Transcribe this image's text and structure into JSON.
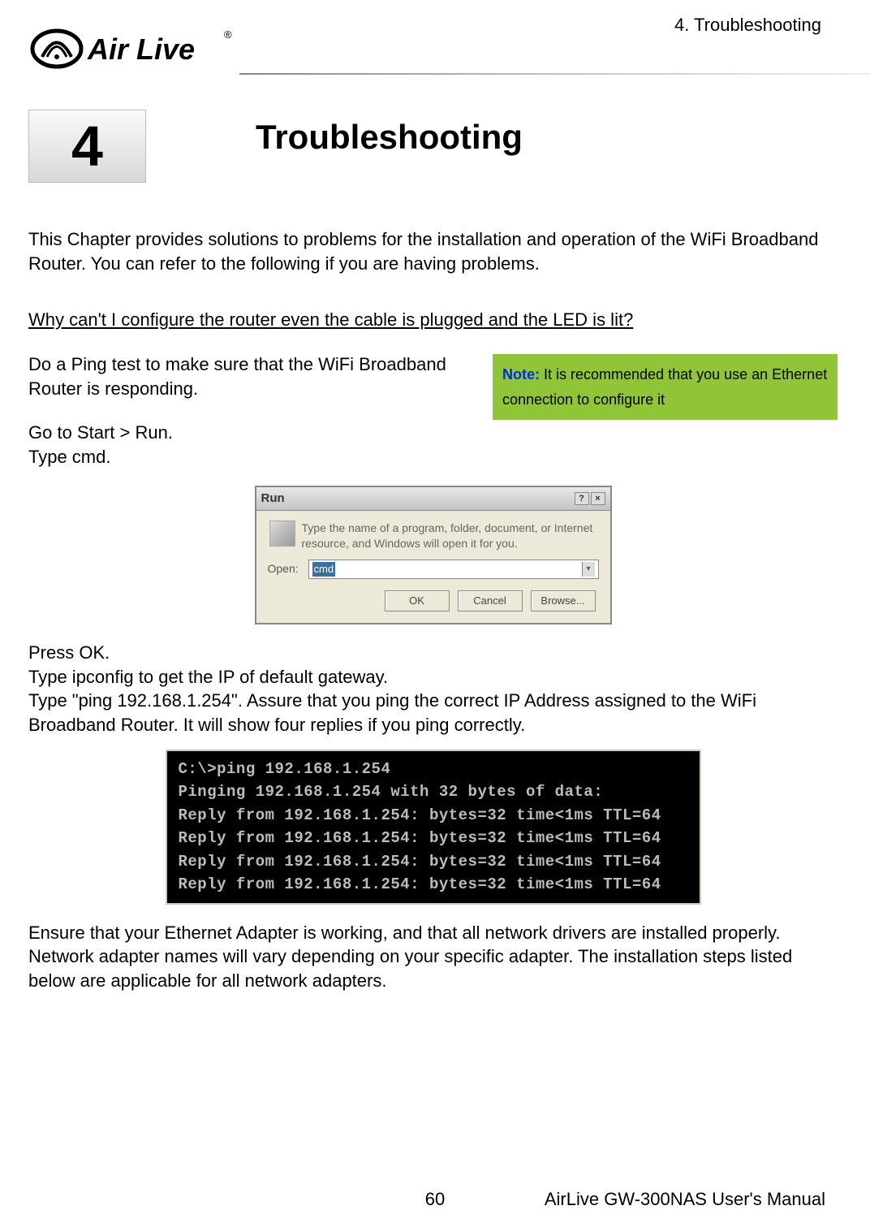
{
  "header": {
    "section_label": "4.  Troubleshooting",
    "brand": "Air Live",
    "brand_registered": "®"
  },
  "chapter": {
    "number": "4",
    "title": "Troubleshooting"
  },
  "intro": "This Chapter provides solutions to problems for the installation and operation of the WiFi Broadband Router. You can refer to the following if you are having problems.",
  "question1": "Why can't I configure the router even the cable is plugged and the LED is lit?  ",
  "note": {
    "label": "Note:",
    "text": " It is recommended that you use an Ethernet connection to configure it"
  },
  "para_ping": "Do a Ping test to make sure that the WiFi Broadband Router is responding.",
  "step_run": "Go to Start > Run.",
  "step_cmd": "Type cmd.",
  "run_dialog": {
    "title": "Run",
    "desc": "Type the name of a program, folder, document, or Internet resource, and Windows will open it for you.",
    "open_label": "Open:",
    "input_value": "cmd",
    "ok": "OK",
    "cancel": "Cancel",
    "browse": "Browse..."
  },
  "press_ok": "Press OK.",
  "step_ipconfig": "Type ipconfig to get the IP of default gateway.",
  "step_ping": "Type \"ping 192.168.1.254\". Assure that you ping the correct IP Address assigned to the WiFi Broadband Router. It will show four replies if you ping correctly.",
  "cmd_output": {
    "l1": "C:\\>ping 192.168.1.254",
    "l2": "",
    "l3": "Pinging 192.168.1.254 with 32 bytes of data:",
    "l4": "",
    "l5": "Reply from 192.168.1.254: bytes=32 time<1ms TTL=64",
    "l6": "Reply from 192.168.1.254: bytes=32 time<1ms TTL=64",
    "l7": "Reply from 192.168.1.254: bytes=32 time<1ms TTL=64",
    "l8": "Reply from 192.168.1.254: bytes=32 time<1ms TTL=64"
  },
  "closing": "Ensure that your Ethernet Adapter is working, and that all network drivers are installed properly. Network adapter names will vary depending on your specific adapter. The installation steps listed below are applicable for all network adapters.",
  "footer": {
    "page": "60",
    "manual": "AirLive GW-300NAS User's Manual"
  }
}
